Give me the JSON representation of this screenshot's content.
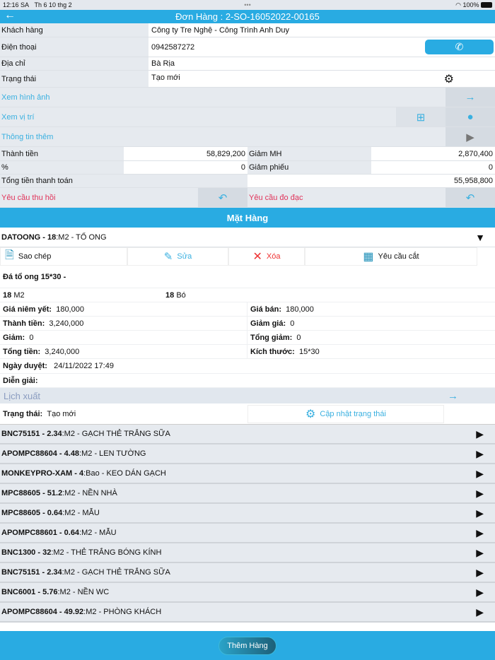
{
  "status": {
    "time": "12:16 SA",
    "date": "Th 6 10 thg 2",
    "battery": "100%"
  },
  "header": {
    "title": "Đơn Hàng : 2-SO-16052022-00165"
  },
  "info": {
    "customer_label": "Khách hàng",
    "customer": "Công ty Tre Nghệ - Công Trình Anh Duy",
    "phone_label": "Điện thoại",
    "phone": "0942587272",
    "address_label": "Địa chỉ",
    "address": "Bà Rịa",
    "status_label": "Trạng thái",
    "status": "Tạo mới",
    "images": "Xem hình ảnh",
    "location": "Xem vị trí",
    "more": "Thông tin thêm"
  },
  "totals": {
    "subtotal_label": "Thành tiền",
    "subtotal": "58,829,200",
    "disc_mh_label": "Giảm MH",
    "disc_mh": "2,870,400",
    "pct_label": "%",
    "pct": "0",
    "disc_slip_label": "Giảm phiếu",
    "disc_slip": "0",
    "total_label": "Tổng tiền thanh toán",
    "total": "55,958,800",
    "recall": "Yêu cầu thu hồi",
    "measure": "Yêu cầu đo đạc"
  },
  "section": "Mặt Hàng",
  "expanded": {
    "code": "DATOONG - 18",
    "unit": ":M2 - TỔ ONG",
    "copy": "Sao chép",
    "edit": "Sửa",
    "delete": "Xóa",
    "cut": "Yêu cầu cắt",
    "desc": "Đá tổ ong 15*30 -",
    "qty1": "18",
    "qty1_unit": "M2",
    "qty2": "18",
    "qty2_unit": "Bó",
    "fields": [
      [
        "Giá niêm yết:",
        "180,000",
        "Giá bán:",
        "180,000"
      ],
      [
        "Thành tiền:",
        "3,240,000",
        "Giảm giá:",
        "0"
      ],
      [
        "Giảm:",
        "0",
        "Tổng giảm:",
        "0"
      ],
      [
        "Tổng tiền:",
        "3,240,000",
        "Kích thước:",
        "15*30"
      ]
    ],
    "approved_label": "Ngày duyệt:",
    "approved": "24/11/2022 17:49",
    "note_label": "Diễn giải:",
    "schedule": "Lịch xuất",
    "status_label": "Trạng thái:",
    "status": "Tạo mới",
    "update_status": "Cập nhật trạng thái"
  },
  "items": [
    {
      "code": "BNC75151 - 2.34",
      "rest": ":M2 - GẠCH THẺ TRẮNG SỮA"
    },
    {
      "code": "APOMPC88604 - 4.48",
      "rest": ":M2 - LEN TƯỜNG"
    },
    {
      "code": "MONKEYPRO-XAM - 4",
      "rest": ":Bao - KEO DÁN GẠCH"
    },
    {
      "code": "MPC88605 - 51.2",
      "rest": ":M2 - NỀN NHÀ"
    },
    {
      "code": "MPC88605 - 0.64",
      "rest": ":M2 - MẪU"
    },
    {
      "code": "APOMPC88601 - 0.64",
      "rest": ":M2 - MẪU"
    },
    {
      "code": "BNC1300 - 32",
      "rest": ":M2 - THẺ TRẮNG BÓNG KÍNH"
    },
    {
      "code": "BNC75151 - 2.34",
      "rest": ":M2 - GẠCH THẺ TRẮNG SỮA"
    },
    {
      "code": "BNC6001 - 5.76",
      "rest": ":M2 - NỀN WC"
    },
    {
      "code": "APOMPC88604 - 49.92",
      "rest": ":M2 - PHÒNG KHÁCH"
    }
  ],
  "add_button": "Thêm Hàng"
}
